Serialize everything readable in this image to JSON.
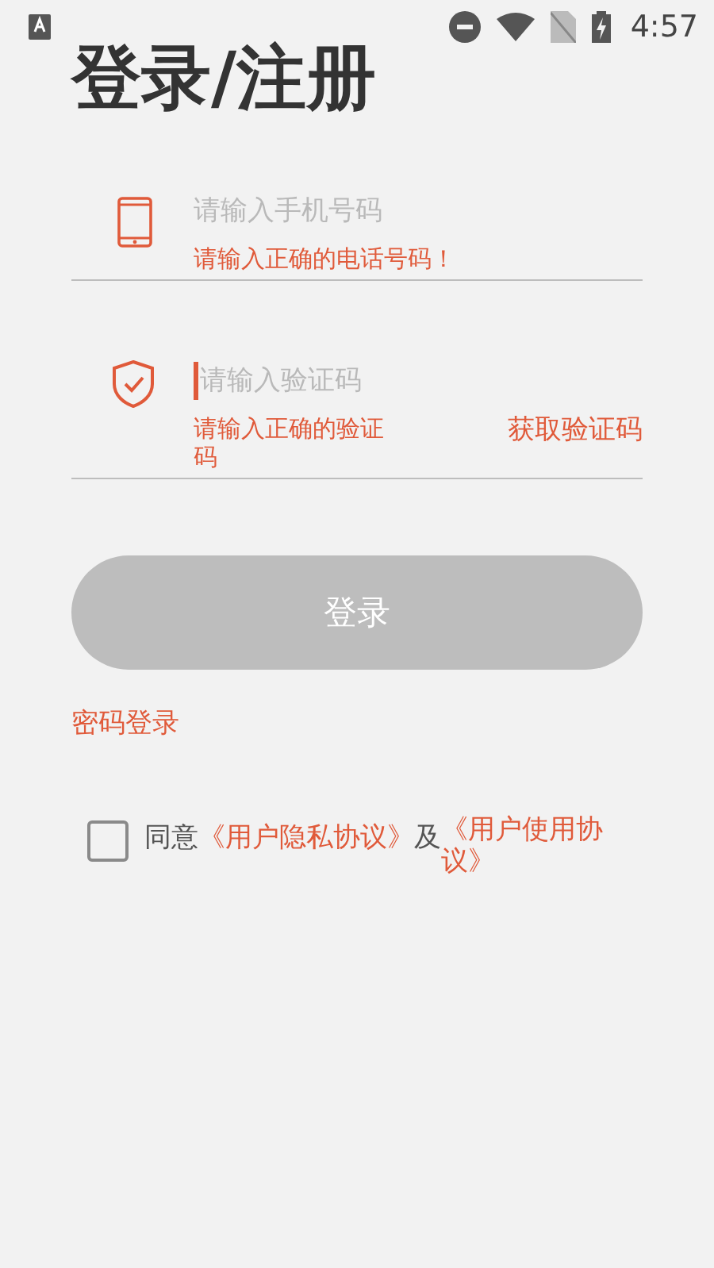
{
  "status_bar": {
    "time": "4:57"
  },
  "title": "登录/注册",
  "fields": [
    {
      "kind": "phone",
      "placeholder": "请输入手机号码",
      "error": "请输入正确的电话号码！",
      "focused": false
    },
    {
      "kind": "code",
      "placeholder": "请输入验证码",
      "error": "请输入正确的验证码",
      "focused": true,
      "action": "获取验证码"
    }
  ],
  "login_button": {
    "label": "登录",
    "disabled": true
  },
  "password_login": "密码登录",
  "agreement": {
    "checked": false,
    "prefix": "同意",
    "privacy_link": "《用户隐私协议》",
    "joiner": "及",
    "terms_link": "《用户使用协议》"
  }
}
